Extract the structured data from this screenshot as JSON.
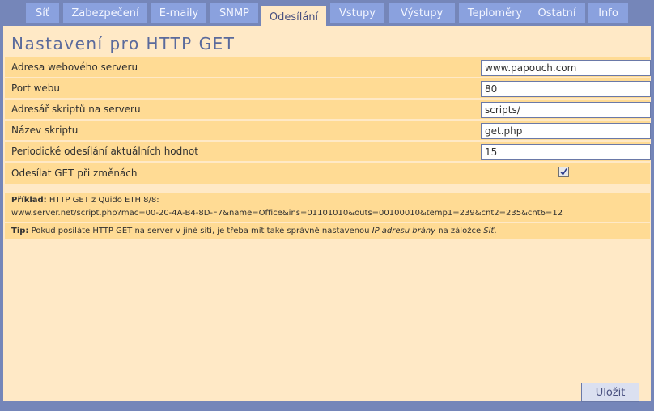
{
  "tabs": [
    {
      "label": "Síť",
      "active": false
    },
    {
      "label": "Zabezpečení",
      "active": false
    },
    {
      "label": "E-maily",
      "active": false
    },
    {
      "label": "SNMP",
      "active": false
    },
    {
      "label": "Odesílání",
      "active": true
    },
    {
      "label": "Vstupy",
      "active": false
    },
    {
      "label": "Výstupy",
      "active": false
    },
    {
      "label": "Teploměry",
      "active": false
    },
    {
      "label": "Ostatní",
      "active": false
    },
    {
      "label": "Info",
      "active": false
    }
  ],
  "page_title": "Nastavení pro HTTP GET",
  "fields": [
    {
      "label": "Adresa webového serveru",
      "value": "www.papouch.com"
    },
    {
      "label": "Port webu",
      "value": "80"
    },
    {
      "label": "Adresář skriptů na serveru",
      "value": "scripts/"
    },
    {
      "label": "Název skriptu",
      "value": "get.php"
    },
    {
      "label": "Periodické odesílání aktuálních hodnot",
      "value": "15"
    }
  ],
  "checkbox_field": {
    "label": "Odesílat GET při změnách",
    "checked": true
  },
  "example": {
    "prefix": "Příklad:",
    "line1": " HTTP GET z Quido ETH 8/8:",
    "line2": "www.server.net/script.php?mac=00-20-4A-B4-8D-F7&name=Office&ins=01101010&outs=00100010&temp1=239&cnt2=235&cnt6=12"
  },
  "tip": {
    "prefix": "Tip:",
    "text1": " Pokud posíláte HTTP GET na server v jiné síti, je třeba mít také správně nastavenou ",
    "italic1": "IP adresu brány",
    "text2": " na záložce ",
    "italic2": "Síť",
    "text3": "."
  },
  "save_label": "Uložit",
  "colors": {
    "frame": "#7586b9",
    "tab": "#8aa1de",
    "panel": "#ffe9c6",
    "row": "#ffdb94"
  }
}
